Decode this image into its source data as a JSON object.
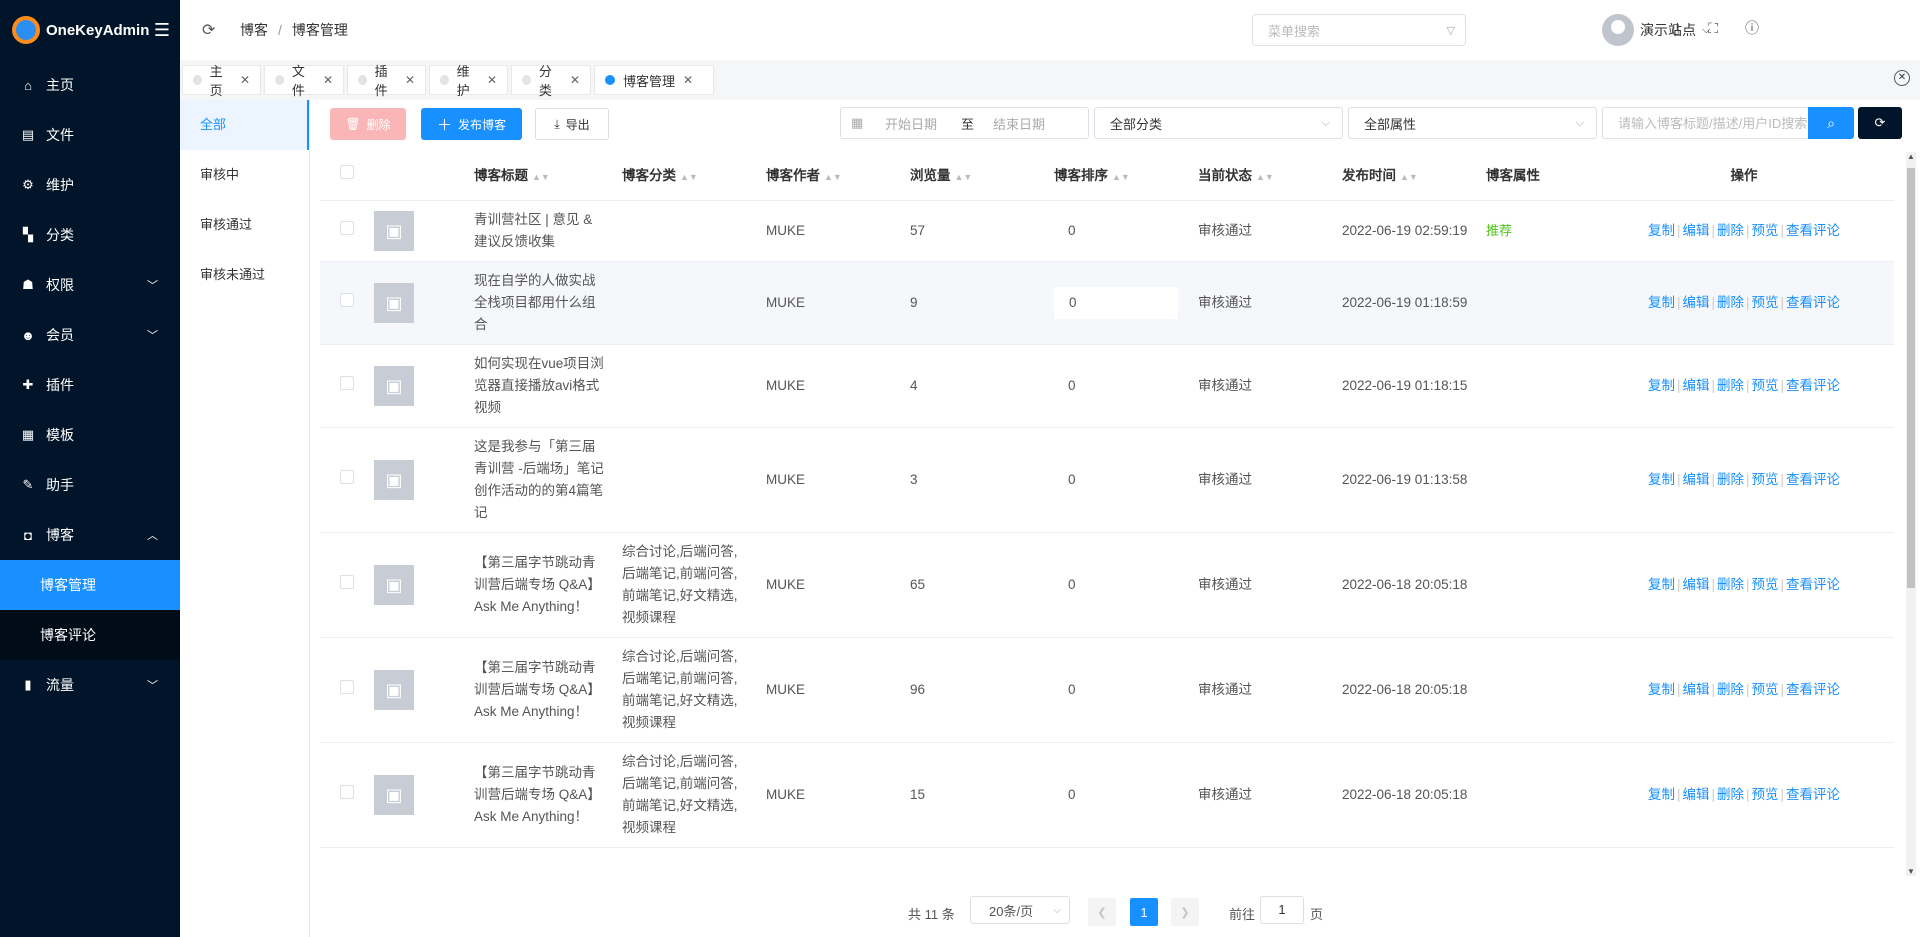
{
  "app": {
    "name": "OneKeyAdmin"
  },
  "sidebar": {
    "items": [
      {
        "label": "主页",
        "icon": "home-icon"
      },
      {
        "label": "文件",
        "icon": "file-icon"
      },
      {
        "label": "维护",
        "icon": "gear-icon"
      },
      {
        "label": "分类",
        "icon": "grid-icon"
      },
      {
        "label": "权限",
        "icon": "user-lock-icon",
        "expandable": true
      },
      {
        "label": "会员",
        "icon": "member-icon",
        "expandable": true
      },
      {
        "label": "插件",
        "icon": "plugin-icon"
      },
      {
        "label": "模板",
        "icon": "template-icon"
      },
      {
        "label": "助手",
        "icon": "assistant-icon"
      },
      {
        "label": "博客",
        "icon": "blog-icon",
        "expanded": true
      },
      {
        "label": "流量",
        "icon": "chart-icon",
        "expandable": true
      }
    ],
    "blog_sub": [
      {
        "label": "博客管理",
        "active": true
      },
      {
        "label": "博客评论"
      }
    ]
  },
  "header": {
    "breadcrumb": [
      "博客",
      "博客管理"
    ],
    "menu_search_placeholder": "菜单搜索",
    "user_name": "演示站点"
  },
  "tabs": [
    {
      "label": "主页"
    },
    {
      "label": "文件"
    },
    {
      "label": "插件"
    },
    {
      "label": "维护"
    },
    {
      "label": "分类"
    },
    {
      "label": "博客管理",
      "active": true
    }
  ],
  "filters": [
    "全部",
    "审核中",
    "审核通过",
    "审核未通过"
  ],
  "toolbar": {
    "delete_label": "删除",
    "publish_label": "发布博客",
    "export_label": "导出",
    "date_start_placeholder": "开始日期",
    "date_to": "至",
    "date_end_placeholder": "结束日期",
    "category_select": "全部分类",
    "attribute_select": "全部属性",
    "search_placeholder": "请输入博客标题/描述/用户ID搜索"
  },
  "table": {
    "headers": [
      "博客标题",
      "博客分类",
      "博客作者",
      "浏览量",
      "博客排序",
      "当前状态",
      "发布时间",
      "博客属性",
      "操作"
    ],
    "ops": [
      "复制",
      "编辑",
      "删除",
      "预览",
      "查看评论"
    ],
    "rows": [
      {
        "title": "青训营社区 | 意见 & 建议反馈收集",
        "category": "",
        "author": "MUKE",
        "views": "57",
        "sort": "0",
        "status": "审核通过",
        "time": "2022-06-19 02:59:19",
        "attr": "推荐"
      },
      {
        "title": "现在自学的人做实战全栈项目都用什么组合",
        "category": "",
        "author": "MUKE",
        "views": "9",
        "sort": "0",
        "status": "审核通过",
        "time": "2022-06-19 01:18:59",
        "attr": "",
        "highlight": true
      },
      {
        "title": "如何实现在vue项目浏览器直接播放avi格式视频",
        "category": "",
        "author": "MUKE",
        "views": "4",
        "sort": "0",
        "status": "审核通过",
        "time": "2022-06-19 01:18:15",
        "attr": ""
      },
      {
        "title": "这是我参与「第三届青训营 -后端场」笔记创作活动的的第4篇笔记",
        "category": "",
        "author": "MUKE",
        "views": "3",
        "sort": "0",
        "status": "审核通过",
        "time": "2022-06-19 01:13:58",
        "attr": ""
      },
      {
        "title": "【第三届字节跳动青训营后端专场 Q&A】Ask Me Anything！",
        "category": "综合讨论,后端问答,后端笔记,前端问答,前端笔记,好文精选,视频课程",
        "author": "MUKE",
        "views": "65",
        "sort": "0",
        "status": "审核通过",
        "time": "2022-06-18 20:05:18",
        "attr": ""
      },
      {
        "title": "【第三届字节跳动青训营后端专场 Q&A】Ask Me Anything！",
        "category": "综合讨论,后端问答,后端笔记,前端问答,前端笔记,好文精选,视频课程",
        "author": "MUKE",
        "views": "96",
        "sort": "0",
        "status": "审核通过",
        "time": "2022-06-18 20:05:18",
        "attr": ""
      },
      {
        "title": "【第三届字节跳动青训营后端专场 Q&A】Ask Me Anything！",
        "category": "综合讨论,后端问答,后端笔记,前端问答,前端笔记,好文精选,视频课程",
        "author": "MUKE",
        "views": "15",
        "sort": "0",
        "status": "审核通过",
        "time": "2022-06-18 20:05:18",
        "attr": ""
      }
    ]
  },
  "pagination": {
    "total": "共 11 条",
    "page_size": "20条/页",
    "current": "1",
    "goto_label": "前往",
    "goto_value": "1",
    "page_unit": "页"
  }
}
